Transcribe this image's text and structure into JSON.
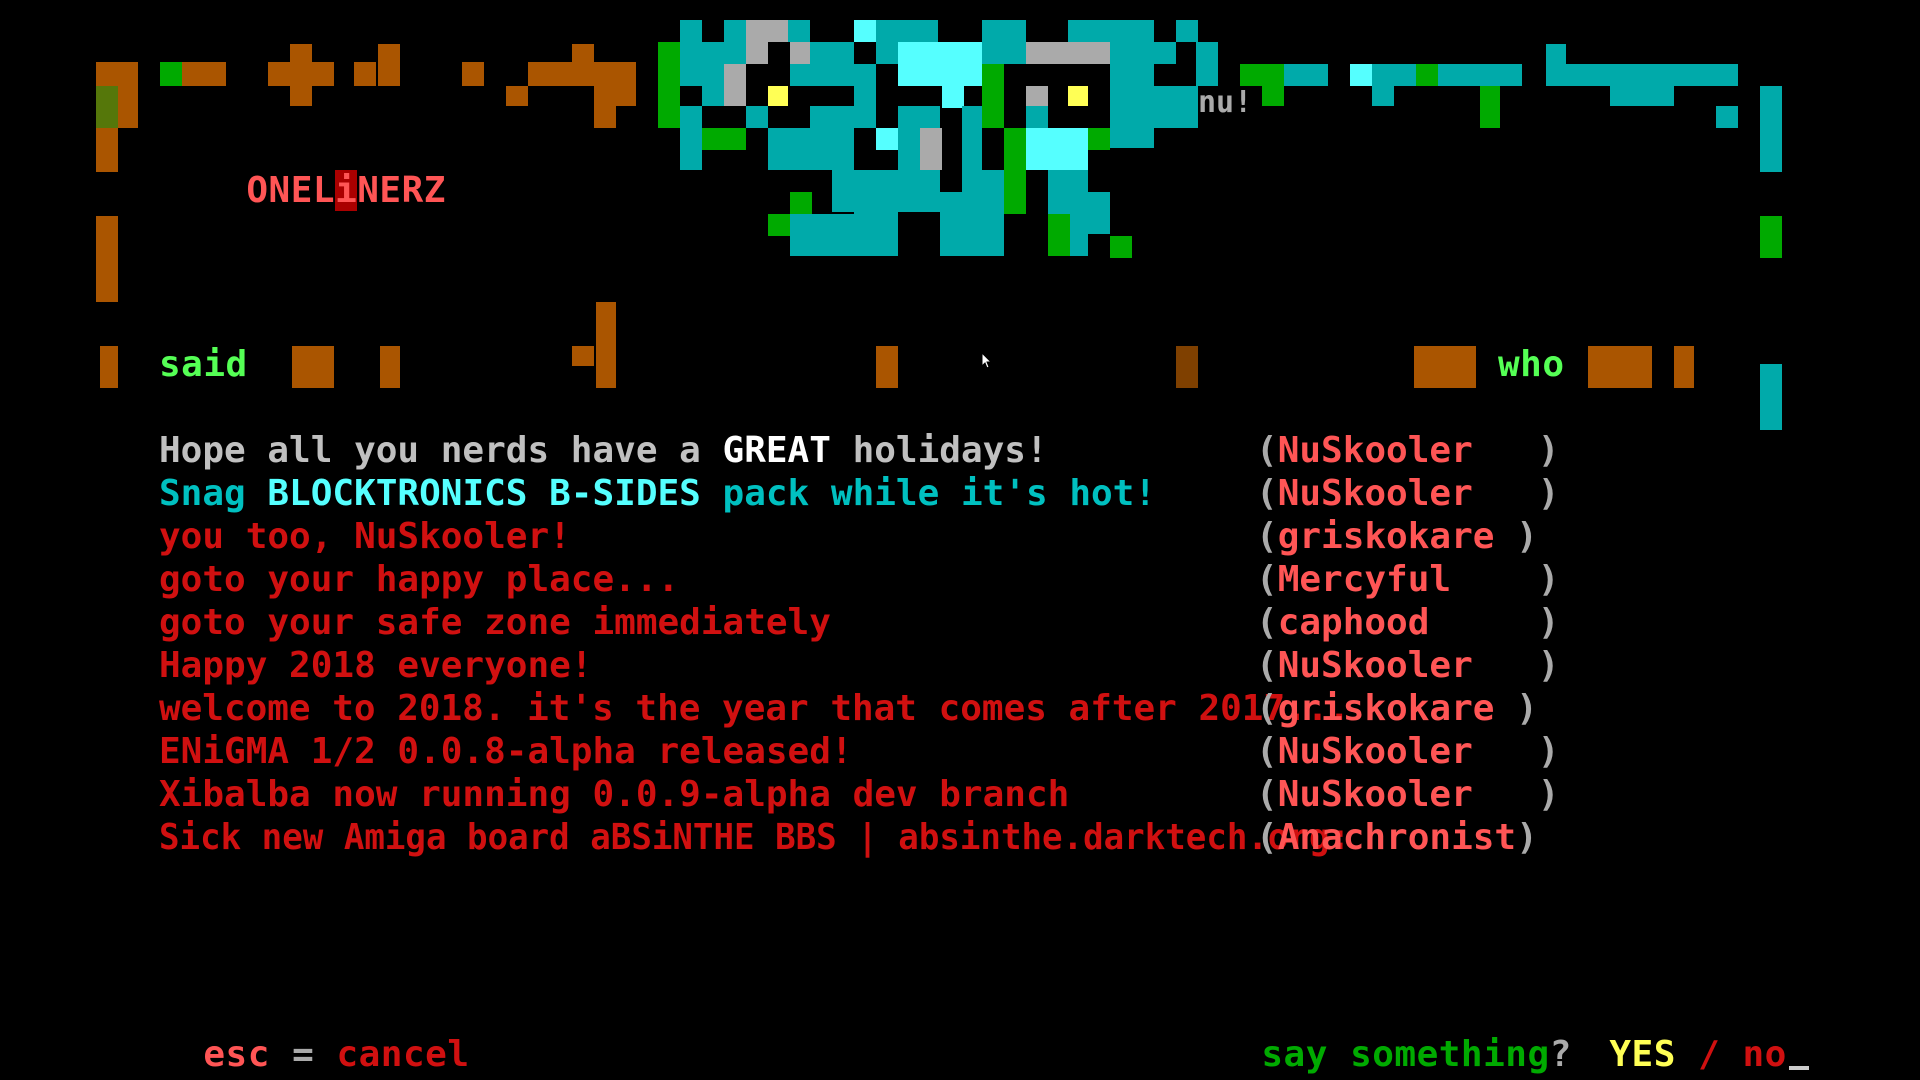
{
  "header": {
    "title": "ONELiNERZ",
    "title_prefix": "ONEL",
    "title_highlight": "i",
    "title_suffix": "NERZ",
    "artist_tag": "nu!"
  },
  "columns": {
    "said": "said",
    "who": "who"
  },
  "oneliners": [
    {
      "segments": [
        {
          "text": "Hope all you nerds have a ",
          "color": "#c0c0c0"
        },
        {
          "text": "GREAT",
          "color": "#ffffff"
        },
        {
          "text": " holidays!",
          "color": "#c0c0c0"
        }
      ],
      "who": "NuSkooler",
      "pad": "   "
    },
    {
      "segments": [
        {
          "text": "Snag ",
          "color": "#00c0c0"
        },
        {
          "text": "BLOCKTRONICS B-SIDES",
          "color": "#55ffff"
        },
        {
          "text": " pack while it's hot!",
          "color": "#00c0c0"
        }
      ],
      "who": "NuSkooler",
      "pad": "   "
    },
    {
      "segments": [
        {
          "text": "you too, NuSkooler!",
          "color": "#d01010"
        }
      ],
      "who": "griskokare",
      "pad": " "
    },
    {
      "segments": [
        {
          "text": "goto your happy place...",
          "color": "#d01010"
        }
      ],
      "who": "Mercyful",
      "pad": "    "
    },
    {
      "segments": [
        {
          "text": "goto your safe zone immediately",
          "color": "#d01010"
        }
      ],
      "who": "caphood",
      "pad": "     "
    },
    {
      "segments": [
        {
          "text": "Happy 2018 everyone!",
          "color": "#d01010"
        }
      ],
      "who": "NuSkooler",
      "pad": "   "
    },
    {
      "segments": [
        {
          "text": "welcome to 2018. it's the year that comes after 2017...",
          "color": "#d01010"
        }
      ],
      "who": "griskokare",
      "pad": " "
    },
    {
      "segments": [
        {
          "text": "ENiGMA 1/2 0.0.8-alpha released!",
          "color": "#d01010"
        }
      ],
      "who": "NuSkooler",
      "pad": "   "
    },
    {
      "segments": [
        {
          "text": "Xibalba now running 0.0.9-alpha dev branch",
          "color": "#d01010"
        }
      ],
      "who": "NuSkooler",
      "pad": "   "
    },
    {
      "segments": [
        {
          "text": "Sick new Amiga board aBSiNTHE BBS | absinthe.darktech.org:",
          "color": "#d01010"
        }
      ],
      "who": "Anachronist",
      "pad": ""
    }
  ],
  "footer": {
    "esc_key": "esc",
    "equals": "=",
    "cancel": "cancel",
    "say_prefix": "say ",
    "say_word": "something",
    "question": "?",
    "yes": "YES",
    "slash": "/",
    "no": "no"
  },
  "colors": {
    "background": "#000000",
    "title": "#ff5555",
    "who_name": "#ff5555",
    "message_red": "#d01010",
    "cyan": "#00aaaa",
    "green": "#00aa00",
    "brown": "#aa5500",
    "yes": "#ffff55"
  }
}
